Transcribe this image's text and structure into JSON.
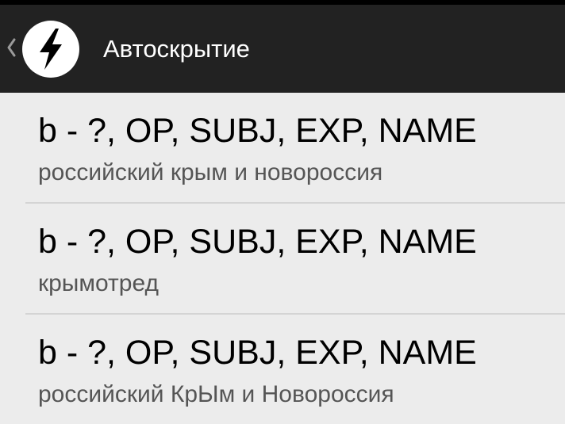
{
  "action_bar": {
    "title": "Автоскрытие",
    "app_icon": "lightning-bolt-icon",
    "back_icon": "back-caret-icon",
    "background": "#222222",
    "title_color": "#ffffff"
  },
  "list": {
    "items": [
      {
        "title": "b - ?, OP, SUBJ, EXP, NAME",
        "summary": "российский крым и новороссия"
      },
      {
        "title": "b - ?, OP, SUBJ, EXP, NAME",
        "summary": "крымотред"
      },
      {
        "title": "b - ?, OP, SUBJ, EXP, NAME",
        "summary": "российский КрЫм и Новороссия"
      }
    ],
    "background": "#ececec",
    "divider_color": "#d4d4d4"
  }
}
